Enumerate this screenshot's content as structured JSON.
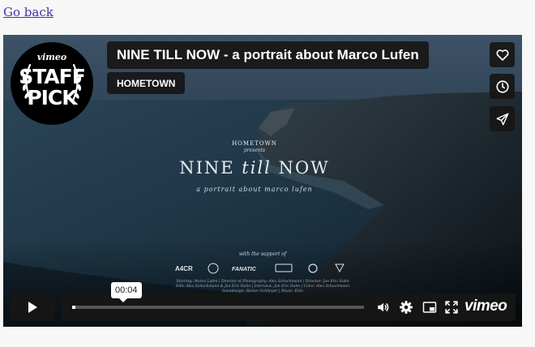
{
  "page": {
    "back_link": "Go back"
  },
  "video": {
    "title": "NINE TILL NOW - a portrait about Marco Lufen",
    "byline": "HOMETOWN",
    "staff_pick": {
      "brand": "vimeo",
      "line1": "STAFF",
      "line2": "PICK"
    },
    "overlay": {
      "presenter": "HOMETOWN",
      "presents": "presents",
      "film_title": "NINE till NOW",
      "subtitle": "a portrait about marco lufen",
      "support": "with the support of",
      "credits_line1": "Starring: Marco Lufen | Director of Photography: Alex Schuchmann | Director: Jan Eric Hahn",
      "credits_line2": "Edit: Alex Schuchmann & Jan Eric Hahn | Interview: Jan Eric Hahn | Color: Alex Schuchmann",
      "credits_line3": "Soundesign: Heiner Schlieper | Music: Eido"
    },
    "side_buttons": [
      {
        "name": "like",
        "icon": "heart-icon"
      },
      {
        "name": "watch-later",
        "icon": "clock-icon"
      },
      {
        "name": "share",
        "icon": "paper-plane-icon"
      }
    ]
  },
  "controls": {
    "current_time": "00:04",
    "progress_fraction": 0.01,
    "brand": "vimeo",
    "icons": [
      "play-icon",
      "volume-icon",
      "settings-gear-icon",
      "picture-in-picture-icon",
      "fullscreen-icon"
    ]
  },
  "colors": {
    "link": "#4a2fa8",
    "overlay_box": "#161616",
    "progress_fill": "#ffffff"
  }
}
